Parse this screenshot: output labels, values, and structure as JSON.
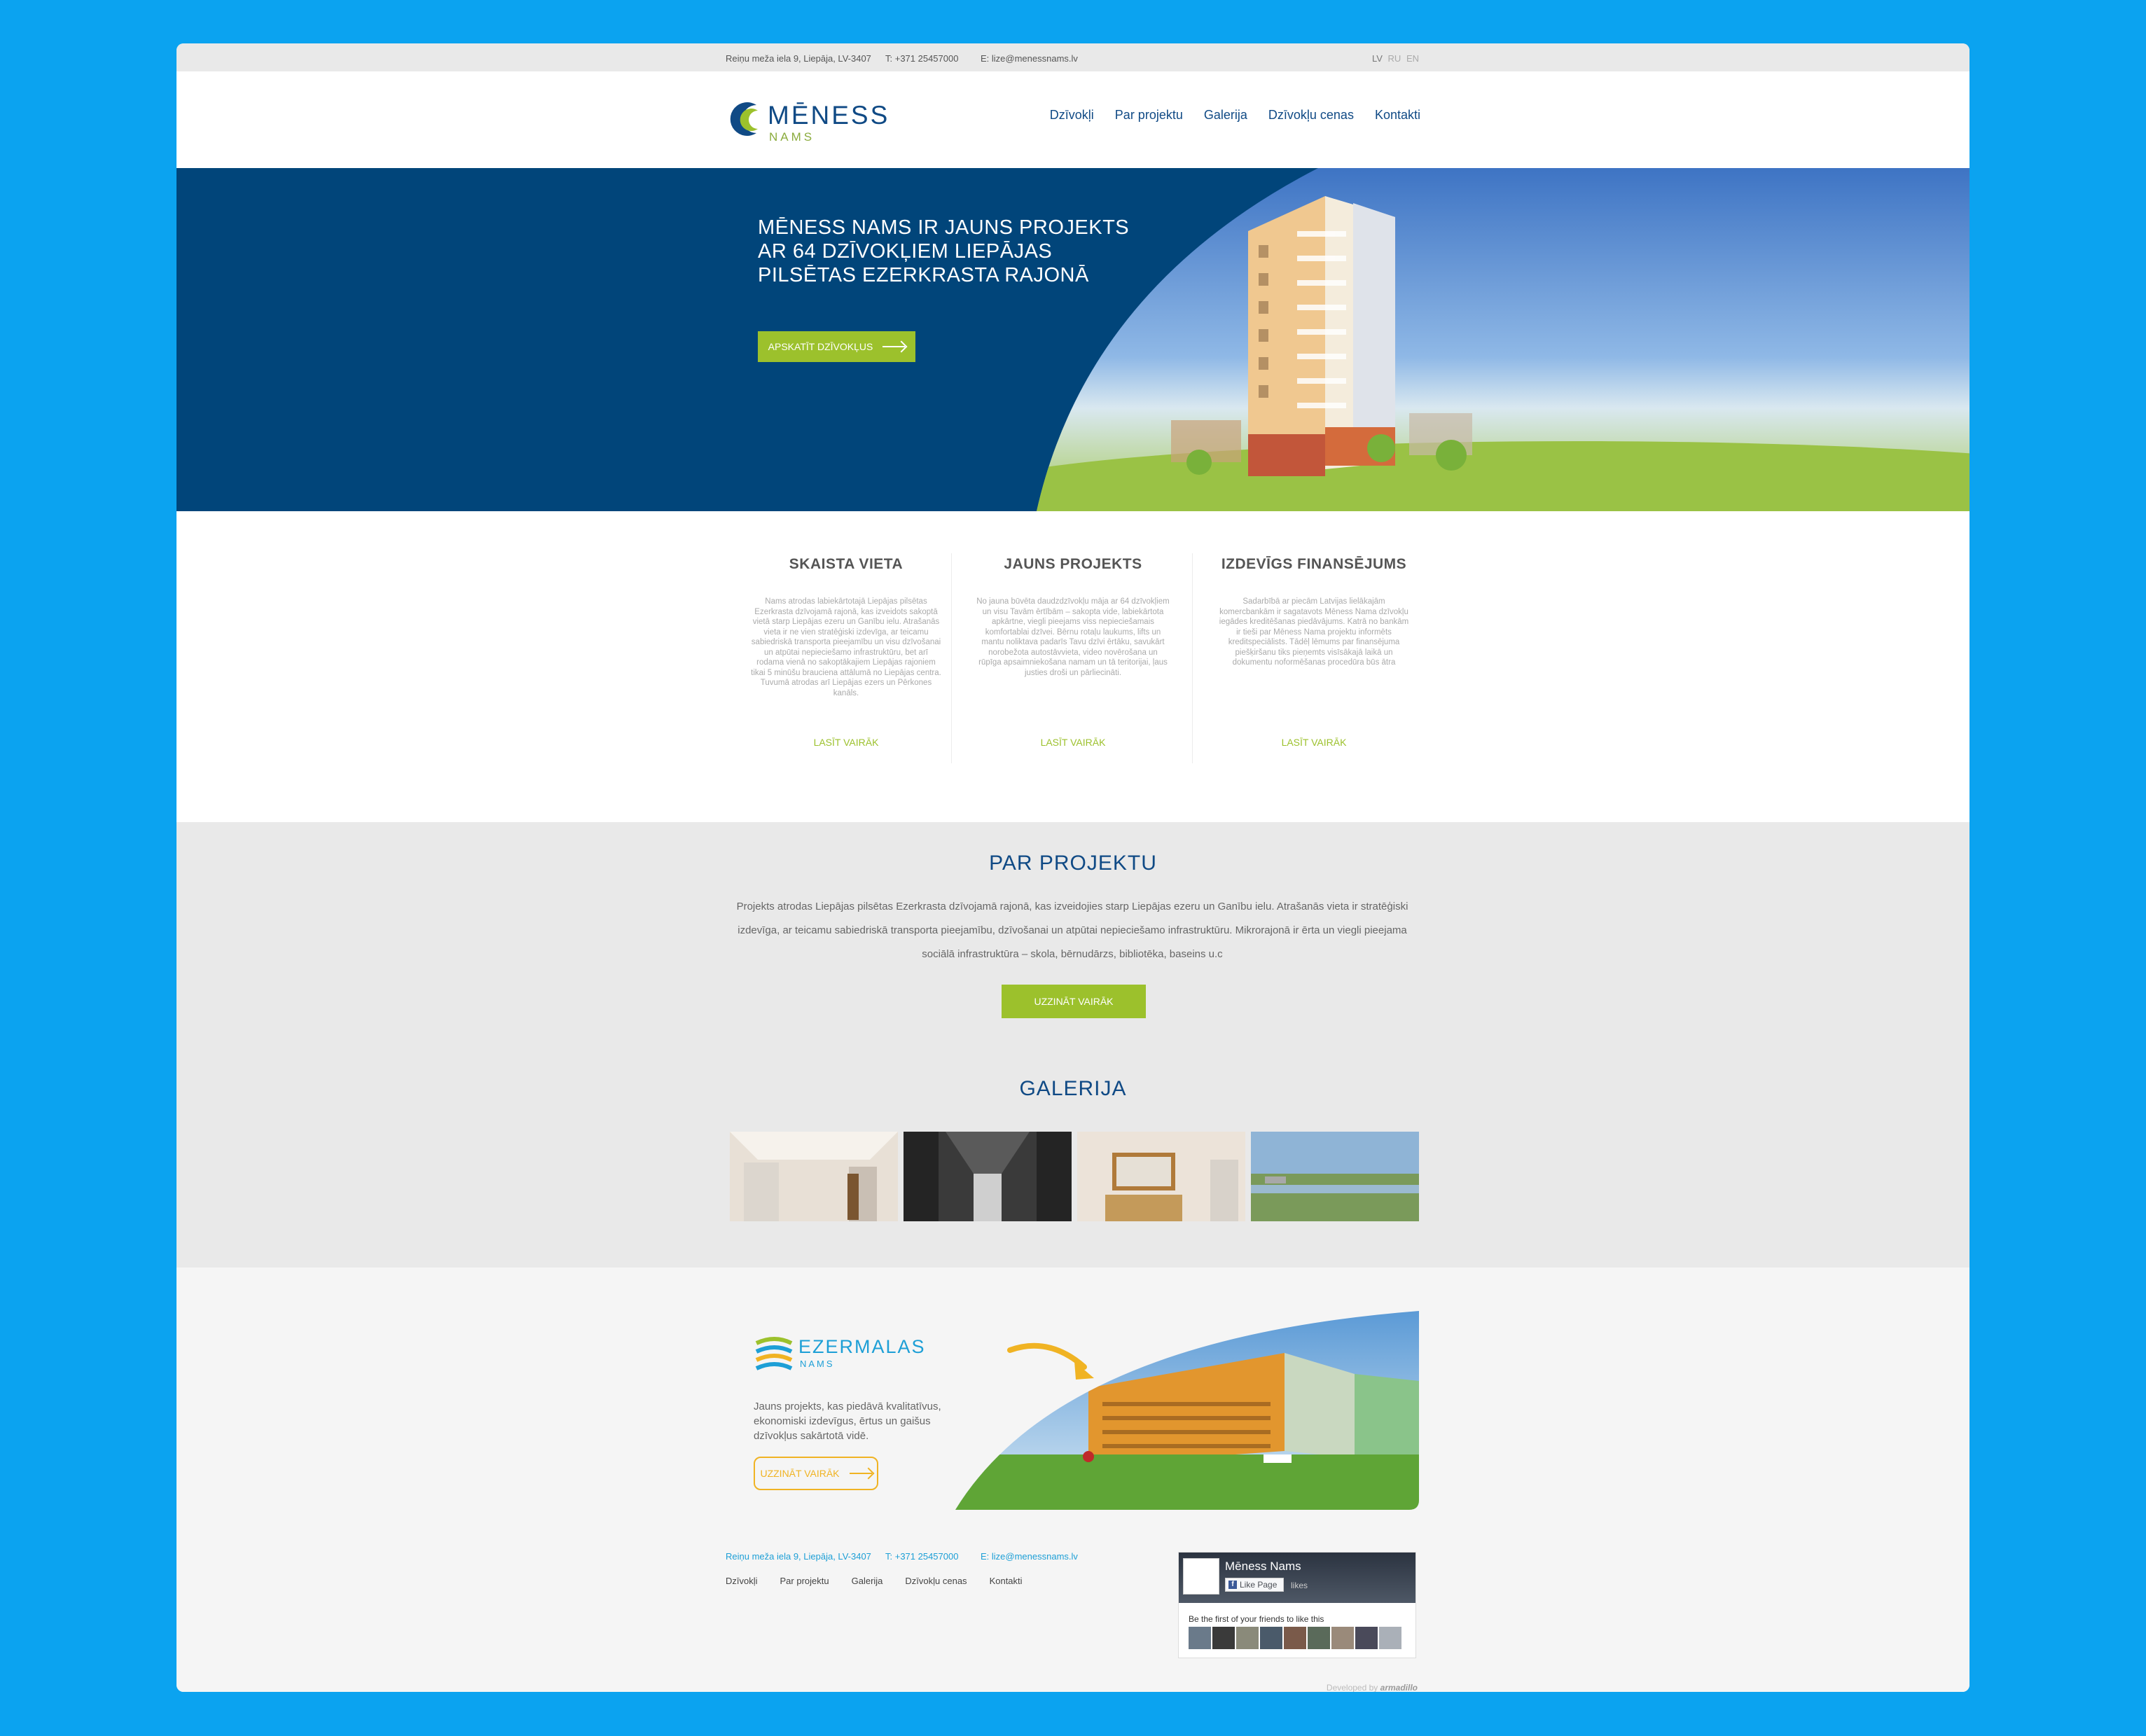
{
  "topbar": {
    "address": "Reiņu meža iela 9, Liepāja, LV-3407",
    "phone": "T: +371 25457000",
    "email": "E: lize@menessnams.lv",
    "languages": [
      "LV",
      "RU",
      "EN"
    ],
    "active_language": "LV"
  },
  "brand": {
    "name": "MĒNESS",
    "sub": "NAMS"
  },
  "nav": [
    "Dzīvokļi",
    "Par projektu",
    "Galerija",
    "Dzīvokļu cenas",
    "Kontakti"
  ],
  "hero": {
    "title": "MĒNESS NAMS IR JAUNS PROJEKTS AR 64 DZĪVOKĻIEM LIEPĀJAS PILSĒTAS EZERKRASTA RAJONĀ",
    "button": "APSKATĪT DZĪVOKĻUS"
  },
  "features": [
    {
      "title": "SKAISTA VIETA",
      "text": "Nams atrodas labiekārtotajā Liepājas pilsētas Ezerkrasta dzīvojamā rajonā, kas izveidots sakoptā vietā starp Liepājas ezeru un Ganību ielu. Atrašanās vieta ir ne vien stratēģiski izdevīga, ar teicamu sabiedriskā transporta pieejamību un visu dzīvošanai un atpūtai nepieciešamo infrastruktūru, bet arī rodama vienā no sakoptākajiem Liepājas rajoniem tikai 5 minūšu brauciena attālumā no Liepājas centra. Tuvumā atrodas arī Liepājas ezers un Pērkones kanāls.",
      "more": "LASĪT VAIRĀK"
    },
    {
      "title": "JAUNS PROJEKTS",
      "text": "No jauna būvēta daudzdzīvokļu māja ar 64 dzīvokļiem un visu Tavām ērtībām – sakopta vide, labiekārtota apkārtne, viegli pieejams viss nepieciešamais komfortablai dzīvei. Bērnu rotaļu laukums, lifts un mantu noliktava padarīs Tavu dzīvi ērtāku, savukārt norobežota autostāvvieta, video novērošana un rūpīga apsaimniekošana namam un tā teritorijai, ļaus justies droši un pārliecināti.",
      "more": "LASĪT VAIRĀK"
    },
    {
      "title": "IZDEVĪGS FINANSĒJUMS",
      "text": "Sadarbībā ar piecām Latvijas lielākajām komercbankām ir sagatavots Mēness Nama dzīvokļu iegādes kreditēšanas piedāvājums. Katrā no bankām ir tieši par Mēness Nama projektu informēts kreditspeciālists. Tādēļ lēmums par finansējuma piešķiršanu tiks pieņemts visīsākajā laikā un dokumentu noformēšanas procedūra būs ātra",
      "more": "LASĪT VAIRĀK"
    }
  ],
  "about": {
    "title": "PAR PROJEKTU",
    "text": "Projekts atrodas Liepājas pilsētas Ezerkrasta dzīvojamā rajonā, kas izveidojies starp Liepājas ezeru un Ganību ielu. Atrašanās vieta ir stratēģiski izdevīga, ar teicamu sabiedriskā transporta pieejamību, dzīvošanai un atpūtai nepieciešamo infrastruktūru. Mikrorajonā ir ērta un viegli pieejama sociālā infrastruktūra – skola, bērnudārzs, bibliotēka, baseins u.c",
    "button": "UZZINĀT VAIRĀK"
  },
  "gallery": {
    "title": "GALERIJA"
  },
  "promo": {
    "brand": "EZERMALAS",
    "sub": "NAMS",
    "text": "Jauns projekts, kas piedāvā kvalitatīvus, ekonomiski izdevīgus, ērtus un gaišus dzīvokļus sakārtotā vidē.",
    "button": "UZZINĀT VAIRĀK"
  },
  "footer": {
    "address": "Reiņu meža iela 9, Liepāja, LV-3407",
    "phone": "T: +371 25457000",
    "email": "E: lize@menessnams.lv",
    "nav": [
      "Dzīvokļi",
      "Par projektu",
      "Galerija",
      "Dzīvokļu cenas",
      "Kontakti"
    ],
    "developed_prefix": "Developed by",
    "developer": "armadillo"
  },
  "facebook": {
    "page_name": "Mēness Nams",
    "like_label": "Like Page",
    "likes_suffix": "likes",
    "friends_text": "Be the first of your friends to like this"
  },
  "colors": {
    "navy": "#01457a",
    "accent_green": "#9cc12c",
    "accent_blue": "#1d9fd6",
    "accent_orange": "#f0b323",
    "background": "#0ba3f0"
  }
}
